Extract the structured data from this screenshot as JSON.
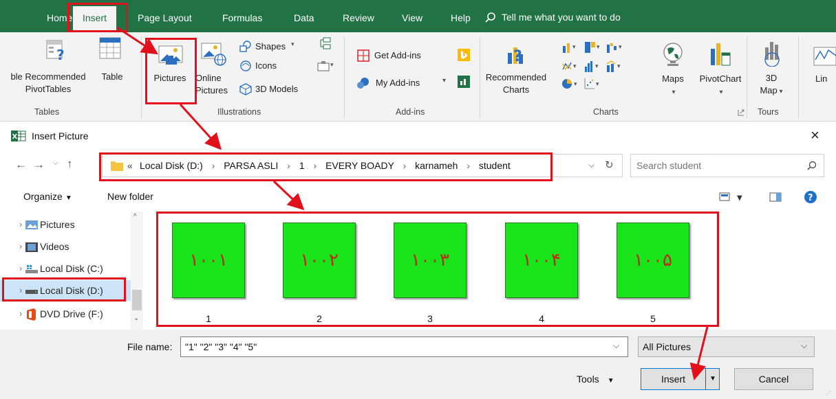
{
  "ribbon_tabs": [
    {
      "label": "Home"
    },
    {
      "label": "Insert"
    },
    {
      "label": "Page Layout"
    },
    {
      "label": "Formulas"
    },
    {
      "label": "Data"
    },
    {
      "label": "Review"
    },
    {
      "label": "View"
    },
    {
      "label": "Help"
    }
  ],
  "tell_me": "Tell me what you want to do",
  "ribbon": {
    "tables": {
      "recommended_l1": "ble Recommended",
      "recommended_l2": "PivotTables",
      "table": "Table",
      "group": "Tables"
    },
    "illustrations": {
      "pictures": "Pictures",
      "online_l1": "Online",
      "online_l2": "Pictures",
      "shapes": "Shapes",
      "icons": "Icons",
      "models": "3D Models",
      "group": "Illustrations"
    },
    "addins": {
      "get": "Get Add-ins",
      "my": "My Add-ins",
      "group": "Add-ins"
    },
    "charts": {
      "rec_l1": "Recommended",
      "rec_l2": "Charts",
      "maps": "Maps",
      "pivotchart": "PivotChart",
      "group": "Charts"
    },
    "tours": {
      "map_l1": "3D",
      "map_l2": "Map",
      "group": "Tours"
    },
    "lin": "Lin"
  },
  "dialog": {
    "title": "Insert Picture",
    "address": [
      "Local Disk (D:)",
      "PARSA ASLI",
      "1",
      "EVERY BOADY",
      "karnameh",
      "student"
    ],
    "search_placeholder": "Search student",
    "organize": "Organize",
    "new_folder": "New folder",
    "nav": [
      {
        "label": "Pictures"
      },
      {
        "label": "Videos"
      },
      {
        "label": "Local Disk (C:)"
      },
      {
        "label": "Local Disk (D:)"
      },
      {
        "label": "DVD Drive (F:)"
      }
    ],
    "files": [
      {
        "name": "1",
        "thumb_text": "۱۰۰۱"
      },
      {
        "name": "2",
        "thumb_text": "۱۰۰۲"
      },
      {
        "name": "3",
        "thumb_text": "۱۰۰۳"
      },
      {
        "name": "4",
        "thumb_text": "۱۰۰۴"
      },
      {
        "name": "5",
        "thumb_text": "۱۰۰۵"
      }
    ],
    "file_name_label": "File name:",
    "file_name_value": "\"1\" \"2\" \"3\" \"4\" \"5\"",
    "filter": "All Pictures",
    "tools": "Tools",
    "insert": "Insert",
    "cancel": "Cancel"
  },
  "colors": {
    "excel_green": "#217346",
    "highlight": "#e1101a",
    "thumb_green": "#19e319",
    "thumb_text": "#c0281e"
  }
}
